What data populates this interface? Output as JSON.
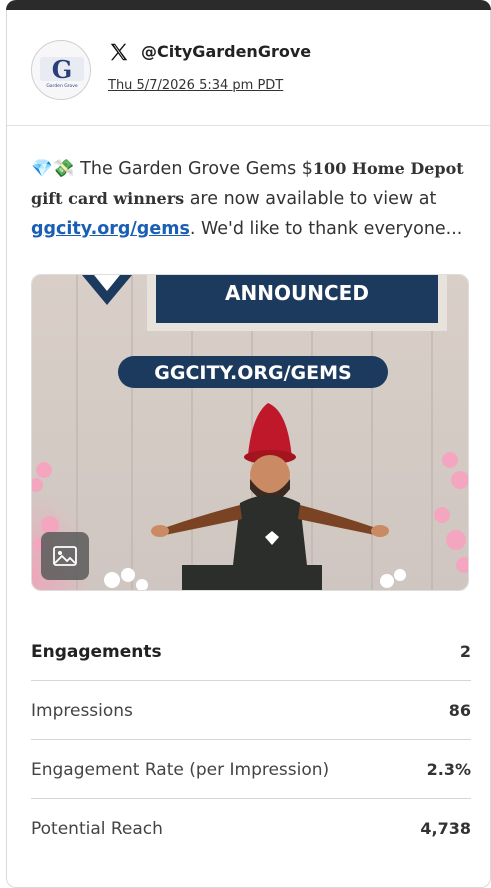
{
  "post": {
    "handle": "@CityGardenGrove",
    "timestamp": "Thu 5/7/2026 5:34 pm PDT",
    "avatar_text": "G",
    "avatar_caption": "Garden Grove",
    "text_emoji": "💎💸",
    "text_part1": " The Garden Grove Gems $",
    "text_bold": "100 Home Depot gift card winners",
    "text_part2": " are now available to view at ",
    "link_text": "ggcity.org/gems",
    "text_part3": ". We'd like to thank everyone..."
  },
  "media": {
    "banner_text": "ANNOUNCED",
    "url_text": "GGCITY.ORG/GEMS",
    "icon": "image-icon"
  },
  "stats": [
    {
      "label": "Engagements",
      "value": "2"
    },
    {
      "label": "Impressions",
      "value": "86"
    },
    {
      "label": "Engagement Rate (per Impression)",
      "value": "2.3%"
    },
    {
      "label": "Potential Reach",
      "value": "4,738"
    }
  ],
  "colors": {
    "link": "#1a5fb4",
    "banner_bg": "#1c3a5e",
    "gnome_hat": "#c0182b"
  }
}
